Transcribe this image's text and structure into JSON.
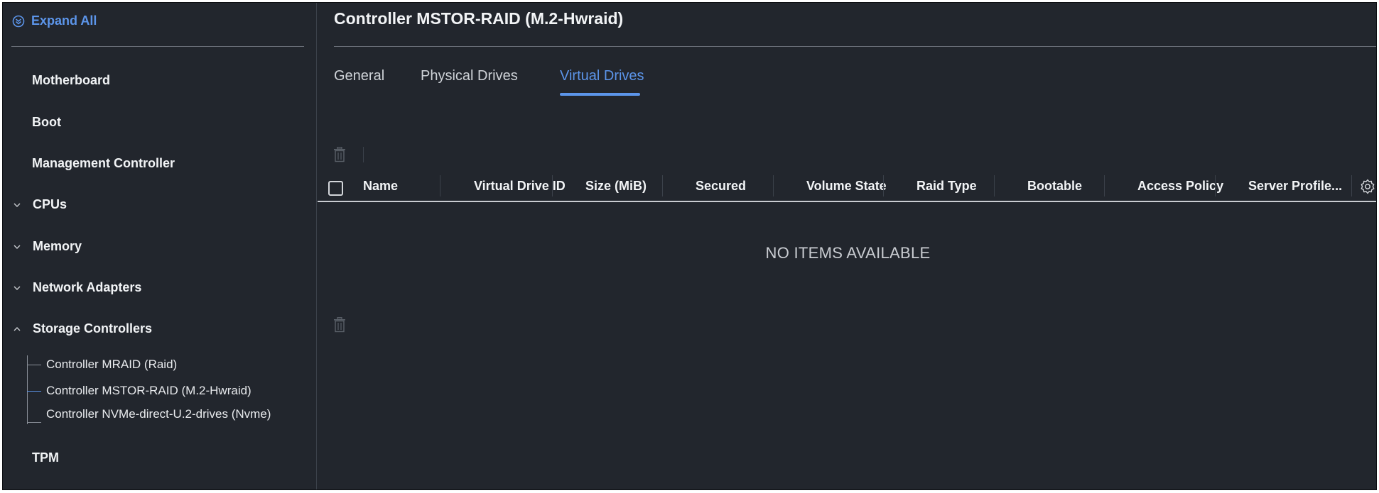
{
  "sidebar": {
    "expand_all": "Expand All",
    "items": [
      {
        "label": "Motherboard"
      },
      {
        "label": "Boot"
      },
      {
        "label": "Management Controller"
      },
      {
        "label": "CPUs"
      },
      {
        "label": "Memory"
      },
      {
        "label": "Network Adapters"
      },
      {
        "label": "Storage Controllers"
      },
      {
        "label": "TPM"
      }
    ],
    "storage_children": [
      {
        "label": "Controller MRAID (Raid)"
      },
      {
        "label": "Controller MSTOR-RAID (M.2-Hwraid)"
      },
      {
        "label": "Controller NVMe-direct-U.2-drives (Nvme)"
      }
    ]
  },
  "main": {
    "title": "Controller MSTOR-RAID (M.2-Hwraid)",
    "tabs": [
      {
        "label": "General"
      },
      {
        "label": "Physical Drives"
      },
      {
        "label": "Virtual Drives",
        "active": true
      }
    ],
    "table": {
      "columns": [
        "Name",
        "Virtual Drive ID",
        "Size (MiB)",
        "Secured",
        "Volume State",
        "Raid Type",
        "Bootable",
        "Access Policy",
        "Server Profile..."
      ],
      "rows": [],
      "empty_message": "NO ITEMS AVAILABLE"
    }
  },
  "colors": {
    "background": "#22262d",
    "accent": "#5c95ea",
    "text": "#f2f4f6"
  }
}
